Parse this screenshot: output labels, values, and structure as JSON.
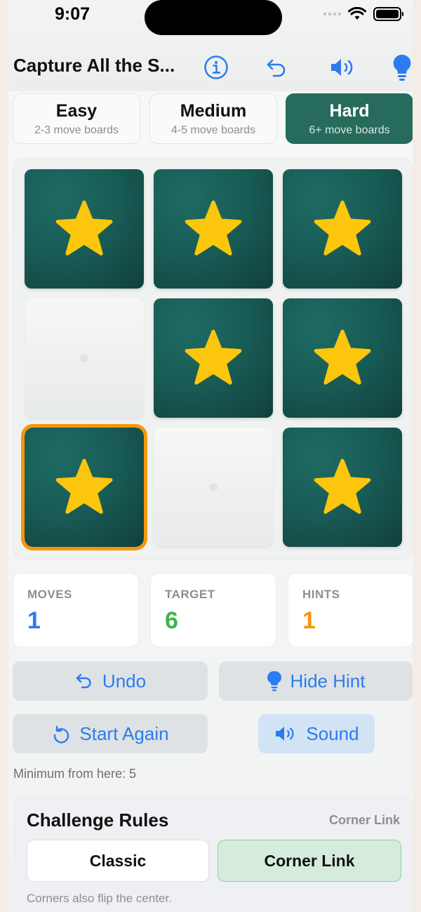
{
  "status_bar": {
    "time": "9:07"
  },
  "header": {
    "title": "Capture All the S...",
    "accent_color": "#2b7cf0",
    "hint_color": "#2b7cf0",
    "icons": [
      "info-icon",
      "undo-icon",
      "speaker-icon",
      "lightbulb-icon"
    ]
  },
  "difficulty": [
    {
      "name": "Easy",
      "sub": "2-3 move boards",
      "selected": false
    },
    {
      "name": "Medium",
      "sub": "4-5 move boards",
      "selected": false
    },
    {
      "name": "Hard",
      "sub": "6+ move boards",
      "selected": true
    }
  ],
  "board": {
    "on_color": "#185a54",
    "star_color": "#fcc60c",
    "selected_outline": "#f7960a",
    "tiles": [
      {
        "state": "star",
        "selected": false
      },
      {
        "state": "star",
        "selected": false
      },
      {
        "state": "star",
        "selected": false
      },
      {
        "state": "empty",
        "selected": false
      },
      {
        "state": "star",
        "selected": false
      },
      {
        "state": "star",
        "selected": false
      },
      {
        "state": "star",
        "selected": true
      },
      {
        "state": "empty",
        "selected": false
      },
      {
        "state": "star",
        "selected": false
      }
    ]
  },
  "stats": {
    "moves": {
      "label": "MOVES",
      "value": "1",
      "color": "#2b7cf0"
    },
    "target": {
      "label": "TARGET",
      "value": "6",
      "color": "#3cb54a"
    },
    "hints": {
      "label": "HINTS",
      "value": "1",
      "color": "#f7960a"
    }
  },
  "actions": {
    "undo": "Undo",
    "hide_hint": "Hide Hint",
    "start_again": "Start Again",
    "sound": "Sound"
  },
  "minimum_text": "Minimum from here: 5",
  "rules": {
    "title": "Challenge Rules",
    "current_mode": "Corner Link",
    "options": [
      "Classic",
      "Corner Link"
    ],
    "selected": "Corner Link",
    "note": "Corners also flip the center."
  }
}
